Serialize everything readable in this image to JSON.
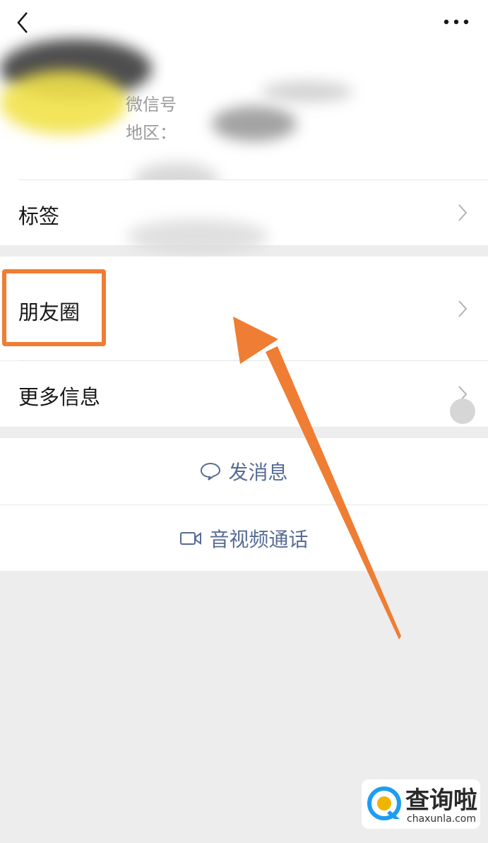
{
  "header": {
    "wechat_id_label": "微信号",
    "region_label": "地区："
  },
  "menu": {
    "tags_label": "标签",
    "moments_label": "朋友圈",
    "more_info_label": "更多信息"
  },
  "actions": {
    "send_message_label": "发消息",
    "video_call_label": "音视频通话"
  },
  "watermark": {
    "title": "查询啦",
    "url": "chaxunla.com"
  },
  "colors": {
    "accent_link": "#576b95",
    "annotation_orange": "#ef7d33",
    "background": "#ededed"
  },
  "icons": {
    "back": "back-chevron-icon",
    "more": "more-dots-icon",
    "chevron": "chevron-right-icon",
    "message": "chat-bubble-icon",
    "video": "video-camera-icon"
  }
}
